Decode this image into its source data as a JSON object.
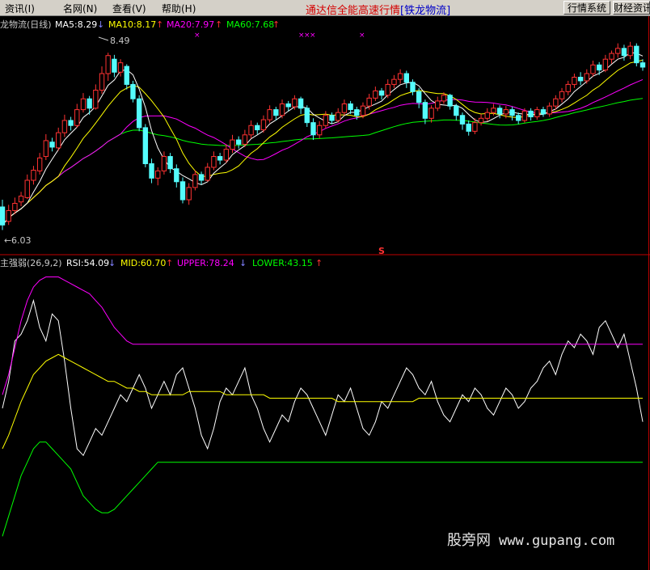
{
  "menu": [
    {
      "label": "资讯(I)",
      "name": "menu-info"
    },
    {
      "label": "名网(N)",
      "name": "menu-famous-sites"
    },
    {
      "label": "查看(V)",
      "name": "menu-view"
    },
    {
      "label": "帮助(H)",
      "name": "menu-help"
    }
  ],
  "banner": {
    "title": "通达信全能高速行情",
    "subtitle": "[铁龙物流]"
  },
  "buttons": {
    "quote_system": "行情系统",
    "finance_info": "财经资讯"
  },
  "main_panel": {
    "stock_period": "龙物流(日线)",
    "ma5": "MA5:8.29",
    "ma10": "MA10:8.17",
    "ma20": "MA20:7.97",
    "ma60": "MA60:7.68",
    "high_label": "8.49",
    "low_label": "6.03",
    "marker_label": "S"
  },
  "indicator_panel": {
    "name": "主强弱(26,9,2)",
    "rsi": "RSI:54.09",
    "mid": "MID:60.70",
    "upper": "UPPER:78.24",
    "lower": "LOWER:43.15"
  },
  "colors": {
    "up": "#ff3232",
    "down": "#54fcfc",
    "ma5": "#ffffff",
    "ma10": "#ffff00",
    "ma20": "#ff00ff",
    "ma60": "#00ff00",
    "rsi": "#ffffff",
    "mid": "#ffff00",
    "upper": "#ff00ff",
    "lower": "#00ff00",
    "frame": "#c00000"
  },
  "chart_data": [
    {
      "type": "candlestick",
      "title": "龙物流(日线)",
      "ylim": [
        5.8,
        8.75
      ],
      "high_marker": 8.49,
      "low_marker": 6.03,
      "candles": [
        [
          6.35,
          6.1,
          6.45,
          6.03
        ],
        [
          6.15,
          6.3,
          6.38,
          6.1
        ],
        [
          6.3,
          6.4,
          6.48,
          6.25
        ],
        [
          6.42,
          6.5,
          6.56,
          6.36
        ],
        [
          6.48,
          6.72,
          6.8,
          6.46
        ],
        [
          6.72,
          6.86,
          6.92,
          6.66
        ],
        [
          6.85,
          7.03,
          7.1,
          6.8
        ],
        [
          7.05,
          7.27,
          7.36,
          7.0
        ],
        [
          7.25,
          7.18,
          7.31,
          7.12
        ],
        [
          7.17,
          7.38,
          7.45,
          7.13
        ],
        [
          7.38,
          7.55,
          7.63,
          7.32
        ],
        [
          7.55,
          7.48,
          7.6,
          7.41
        ],
        [
          7.48,
          7.7,
          7.78,
          7.45
        ],
        [
          7.7,
          7.85,
          7.93,
          7.66
        ],
        [
          7.85,
          7.72,
          7.89,
          7.63
        ],
        [
          7.72,
          7.97,
          8.05,
          7.7
        ],
        [
          7.97,
          8.2,
          8.3,
          7.92
        ],
        [
          8.2,
          8.45,
          8.49,
          8.1
        ],
        [
          8.4,
          8.22,
          8.46,
          8.15
        ],
        [
          8.22,
          8.35,
          8.4,
          8.16
        ],
        [
          8.3,
          8.05,
          8.33,
          7.98
        ],
        [
          8.05,
          7.85,
          8.1,
          7.8
        ],
        [
          7.85,
          7.45,
          7.9,
          7.4
        ],
        [
          7.45,
          6.95,
          7.5,
          6.9
        ],
        [
          6.95,
          6.75,
          7.02,
          6.68
        ],
        [
          6.75,
          6.85,
          6.9,
          6.65
        ],
        [
          6.85,
          7.05,
          7.12,
          6.8
        ],
        [
          7.05,
          6.88,
          7.1,
          6.82
        ],
        [
          6.88,
          6.7,
          6.94,
          6.62
        ],
        [
          6.7,
          6.45,
          6.76,
          6.4
        ],
        [
          6.45,
          6.62,
          6.68,
          6.38
        ],
        [
          6.62,
          6.8,
          6.86,
          6.58
        ],
        [
          6.8,
          6.72,
          6.84,
          6.66
        ],
        [
          6.72,
          6.9,
          6.96,
          6.7
        ],
        [
          6.9,
          7.05,
          7.12,
          6.86
        ],
        [
          7.05,
          7.0,
          7.1,
          6.94
        ],
        [
          7.0,
          7.15,
          7.22,
          6.96
        ],
        [
          7.15,
          7.28,
          7.35,
          7.1
        ],
        [
          7.28,
          7.22,
          7.33,
          7.16
        ],
        [
          7.22,
          7.35,
          7.42,
          7.18
        ],
        [
          7.35,
          7.48,
          7.55,
          7.3
        ],
        [
          7.48,
          7.42,
          7.52,
          7.36
        ],
        [
          7.42,
          7.56,
          7.62,
          7.38
        ],
        [
          7.56,
          7.7,
          7.76,
          7.52
        ],
        [
          7.7,
          7.62,
          7.74,
          7.55
        ],
        [
          7.62,
          7.78,
          7.84,
          7.58
        ],
        [
          7.78,
          7.74,
          7.82,
          7.68
        ],
        [
          7.74,
          7.85,
          7.9,
          7.7
        ],
        [
          7.85,
          7.72,
          7.88,
          7.64
        ],
        [
          7.72,
          7.52,
          7.76,
          7.46
        ],
        [
          7.52,
          7.35,
          7.58,
          7.28
        ],
        [
          7.35,
          7.48,
          7.54,
          7.3
        ],
        [
          7.48,
          7.62,
          7.68,
          7.44
        ],
        [
          7.62,
          7.55,
          7.66,
          7.5
        ],
        [
          7.55,
          7.66,
          7.72,
          7.52
        ],
        [
          7.66,
          7.78,
          7.84,
          7.62
        ],
        [
          7.78,
          7.7,
          7.82,
          7.64
        ],
        [
          7.7,
          7.62,
          7.74,
          7.56
        ],
        [
          7.62,
          7.75,
          7.8,
          7.58
        ],
        [
          7.75,
          7.86,
          7.92,
          7.7
        ],
        [
          7.86,
          7.96,
          8.02,
          7.82
        ],
        [
          7.96,
          7.9,
          8.0,
          7.84
        ],
        [
          7.9,
          8.05,
          8.12,
          7.86
        ],
        [
          8.05,
          8.12,
          8.18,
          8.0
        ],
        [
          8.12,
          8.2,
          8.26,
          8.06
        ],
        [
          8.2,
          8.08,
          8.24,
          8.0
        ],
        [
          8.08,
          7.95,
          8.12,
          7.9
        ],
        [
          7.95,
          7.8,
          8.0,
          7.72
        ],
        [
          7.8,
          7.58,
          7.84,
          7.5
        ],
        [
          7.58,
          7.72,
          7.76,
          7.52
        ],
        [
          7.72,
          7.82,
          7.88,
          7.68
        ],
        [
          7.82,
          7.9,
          7.94,
          7.78
        ],
        [
          7.9,
          7.75,
          7.92,
          7.7
        ],
        [
          7.75,
          7.62,
          7.78,
          7.55
        ],
        [
          7.62,
          7.5,
          7.66,
          7.42
        ],
        [
          7.5,
          7.4,
          7.55,
          7.34
        ],
        [
          7.4,
          7.52,
          7.58,
          7.36
        ],
        [
          7.52,
          7.58,
          7.64,
          7.48
        ],
        [
          7.58,
          7.66,
          7.72,
          7.54
        ],
        [
          7.66,
          7.72,
          7.78,
          7.62
        ],
        [
          7.72,
          7.64,
          7.76,
          7.58
        ],
        [
          7.64,
          7.7,
          7.75,
          7.58
        ],
        [
          7.7,
          7.62,
          7.74,
          7.55
        ],
        [
          7.62,
          7.55,
          7.66,
          7.5
        ],
        [
          7.55,
          7.68,
          7.72,
          7.52
        ],
        [
          7.68,
          7.6,
          7.72,
          7.55
        ],
        [
          7.6,
          7.7,
          7.74,
          7.56
        ],
        [
          7.7,
          7.64,
          7.74,
          7.6
        ],
        [
          7.64,
          7.75,
          7.8,
          7.6
        ],
        [
          7.75,
          7.85,
          7.9,
          7.7
        ],
        [
          7.85,
          7.95,
          8.0,
          7.8
        ],
        [
          7.95,
          8.05,
          8.1,
          7.9
        ],
        [
          8.05,
          8.15,
          8.2,
          8.0
        ],
        [
          8.15,
          8.1,
          8.22,
          8.04
        ],
        [
          8.1,
          8.2,
          8.26,
          8.06
        ],
        [
          8.2,
          8.32,
          8.38,
          8.16
        ],
        [
          8.32,
          8.25,
          8.36,
          8.18
        ],
        [
          8.25,
          8.4,
          8.46,
          8.22
        ],
        [
          8.4,
          8.48,
          8.52,
          8.34
        ],
        [
          8.48,
          8.55,
          8.62,
          8.42
        ],
        [
          8.55,
          8.45,
          8.6,
          8.38
        ],
        [
          8.45,
          8.58,
          8.64,
          8.4
        ],
        [
          8.58,
          8.35,
          8.62,
          8.3
        ],
        [
          8.35,
          8.29,
          8.4,
          8.24
        ]
      ]
    },
    {
      "type": "line",
      "title": "主强弱(26,9,2)",
      "ylim": [
        10,
        100
      ],
      "series": [
        {
          "name": "RSI",
          "values": [
            58,
            66,
            78,
            80,
            84,
            90,
            82,
            78,
            86,
            84,
            72,
            58,
            46,
            44,
            48,
            52,
            50,
            54,
            58,
            62,
            60,
            64,
            68,
            64,
            58,
            62,
            66,
            62,
            68,
            70,
            64,
            58,
            50,
            46,
            52,
            60,
            64,
            62,
            66,
            70,
            62,
            58,
            52,
            48,
            52,
            56,
            54,
            60,
            64,
            62,
            58,
            54,
            50,
            56,
            62,
            60,
            64,
            58,
            52,
            50,
            54,
            60,
            58,
            62,
            66,
            70,
            68,
            64,
            62,
            66,
            60,
            56,
            54,
            58,
            62,
            60,
            64,
            62,
            58,
            56,
            60,
            64,
            62,
            58,
            60,
            64,
            66,
            70,
            72,
            68,
            74,
            78,
            76,
            80,
            78,
            74,
            82,
            84,
            80,
            76,
            80,
            72,
            64,
            54
          ]
        },
        {
          "name": "MID",
          "values": [
            46,
            50,
            55,
            60,
            64,
            68,
            70,
            72,
            73,
            74,
            73,
            72,
            71,
            70,
            69,
            68,
            67,
            66,
            66,
            65,
            64,
            64,
            63,
            63,
            62,
            62,
            62,
            62,
            62,
            62,
            63,
            63,
            63,
            63,
            63,
            63,
            62,
            62,
            62,
            62,
            62,
            62,
            62,
            61,
            61,
            61,
            61,
            61,
            61,
            61,
            61,
            61,
            61,
            61,
            60,
            60,
            60,
            60,
            60,
            60,
            60,
            60,
            60,
            60,
            60,
            60,
            60,
            61,
            61,
            61,
            61,
            61,
            61,
            61,
            61,
            61,
            61,
            61,
            61,
            61,
            61,
            61,
            61,
            61,
            61,
            61,
            61,
            61,
            61,
            61,
            61,
            61,
            61,
            61,
            61,
            61,
            61,
            61,
            61,
            61,
            61,
            61,
            61,
            61
          ]
        },
        {
          "name": "UPPER",
          "values": [
            62,
            68,
            76,
            84,
            90,
            94,
            96,
            97,
            97,
            97,
            96,
            95,
            94,
            93,
            92,
            90,
            88,
            85,
            82,
            80,
            78,
            77,
            77,
            77,
            77,
            77,
            77,
            77,
            77,
            77,
            77,
            77,
            77,
            77,
            77,
            77,
            77,
            77,
            77,
            77,
            77,
            77,
            77,
            77,
            77,
            77,
            77,
            77,
            77,
            77,
            77,
            77,
            77,
            77,
            77,
            77,
            77,
            77,
            77,
            77,
            77,
            77,
            77,
            77,
            77,
            77,
            77,
            77,
            77,
            77,
            77,
            77,
            77,
            77,
            77,
            77,
            77,
            77,
            77,
            77,
            77,
            77,
            77,
            77,
            77,
            77,
            77,
            77,
            77,
            77,
            77,
            77,
            77,
            77,
            77,
            77,
            77,
            77,
            77,
            77,
            77,
            77,
            77,
            77
          ]
        },
        {
          "name": "LOWER",
          "values": [
            20,
            26,
            32,
            38,
            42,
            46,
            48,
            48,
            46,
            44,
            42,
            40,
            36,
            32,
            30,
            28,
            27,
            27,
            28,
            30,
            32,
            34,
            36,
            38,
            40,
            42,
            42,
            42,
            42,
            42,
            42,
            42,
            42,
            42,
            42,
            42,
            42,
            42,
            42,
            42,
            42,
            42,
            42,
            42,
            42,
            42,
            42,
            42,
            42,
            42,
            42,
            42,
            42,
            42,
            42,
            42,
            42,
            42,
            42,
            42,
            42,
            42,
            42,
            42,
            42,
            42,
            42,
            42,
            42,
            42,
            42,
            42,
            42,
            42,
            42,
            42,
            42,
            42,
            42,
            42,
            42,
            42,
            42,
            42,
            42,
            42,
            42,
            42,
            42,
            42,
            42,
            42,
            42,
            42,
            42,
            42,
            42,
            42,
            42,
            42,
            42,
            42,
            42,
            42
          ]
        }
      ]
    }
  ],
  "watermark": {
    "brand": "股旁网",
    "url": "www.gupang.com"
  }
}
